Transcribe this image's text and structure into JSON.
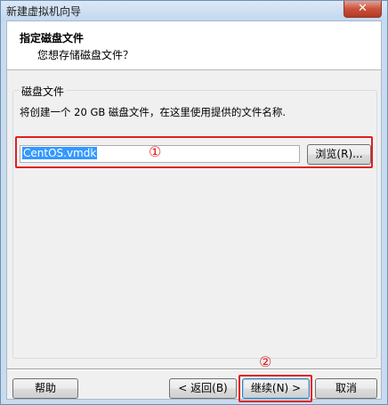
{
  "window": {
    "title": "新建虚拟机向导",
    "close_glyph": "✕"
  },
  "header": {
    "title": "指定磁盘文件",
    "subtitle": "您想存储磁盘文件？"
  },
  "disk_file_group": {
    "legend": "磁盘文件",
    "description": "将创建一个 20 GB 磁盘文件，在这里使用提供的文件名称.",
    "file_input_value": "CentOS.vmdk",
    "browse_label": "浏览(R)..."
  },
  "footer": {
    "help_label": "帮助",
    "back_label": "< 返回(B)",
    "next_label": "继续(N) >",
    "cancel_label": "取消"
  },
  "annotations": {
    "marker_1": "①",
    "marker_2": "②",
    "accent_color": "#e02020"
  }
}
